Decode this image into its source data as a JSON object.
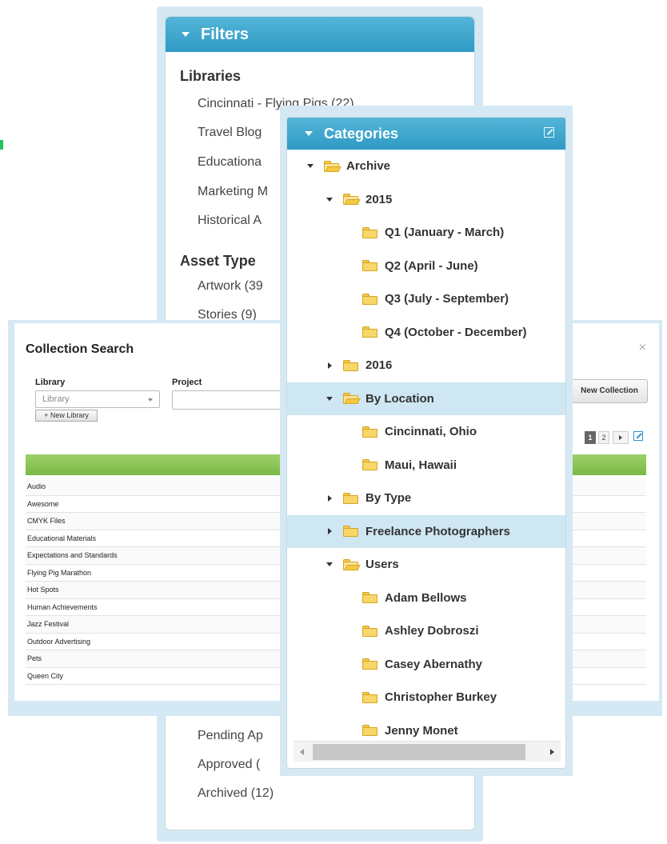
{
  "filters": {
    "title": "Filters",
    "libraries_heading": "Libraries",
    "libraries": [
      "Cincinnati - Flying Pigs (22)",
      "Travel Blog",
      "Educationa",
      "Marketing M",
      "Historical A"
    ],
    "asset_type_heading": "Asset Type",
    "asset_types": [
      "Artwork (39",
      "Stories (9)"
    ],
    "statuses": [
      "Pending Ap",
      "Approved (",
      "Archived (12)"
    ]
  },
  "collection_search": {
    "title": "Collection Search",
    "close": "×",
    "library_label": "Library",
    "library_placeholder": "Library",
    "project_label": "Project",
    "new_library": "+ New Library",
    "new_collection": "New Collection",
    "pages": [
      "1",
      "2"
    ],
    "rows": [
      "Audio",
      "Awesome",
      "CMYK Files",
      "Educational Materials",
      "Expectations and Standards",
      "Flying Pig Marathon",
      "Hot Spots",
      "Human Achievements",
      "Jazz Festival",
      "Outdoor Advertising",
      "Pets",
      "Queen City"
    ]
  },
  "categories": {
    "title": "Categories",
    "tree": [
      {
        "label": "Archive",
        "depth": 0,
        "toggle": "down",
        "open": true,
        "selected": false
      },
      {
        "label": "2015",
        "depth": 1,
        "toggle": "down",
        "open": true,
        "selected": false
      },
      {
        "label": "Q1 (January - March)",
        "depth": 2,
        "toggle": "none",
        "open": false,
        "selected": false
      },
      {
        "label": "Q2 (April - June)",
        "depth": 2,
        "toggle": "none",
        "open": false,
        "selected": false
      },
      {
        "label": "Q3 (July - September)",
        "depth": 2,
        "toggle": "none",
        "open": false,
        "selected": false
      },
      {
        "label": "Q4 (October - December)",
        "depth": 2,
        "toggle": "none",
        "open": false,
        "selected": false
      },
      {
        "label": "2016",
        "depth": 1,
        "toggle": "right",
        "open": false,
        "selected": false
      },
      {
        "label": "By Location",
        "depth": 1,
        "toggle": "down",
        "open": true,
        "selected": true
      },
      {
        "label": "Cincinnati, Ohio",
        "depth": 2,
        "toggle": "none",
        "open": false,
        "selected": false
      },
      {
        "label": "Maui, Hawaii",
        "depth": 2,
        "toggle": "none",
        "open": false,
        "selected": false
      },
      {
        "label": "By Type",
        "depth": 1,
        "toggle": "right",
        "open": false,
        "selected": false
      },
      {
        "label": "Freelance Photographers",
        "depth": 1,
        "toggle": "right",
        "open": false,
        "selected": true
      },
      {
        "label": "Users",
        "depth": 1,
        "toggle": "down",
        "open": true,
        "selected": false
      },
      {
        "label": "Adam Bellows",
        "depth": 2,
        "toggle": "none",
        "open": false,
        "selected": false
      },
      {
        "label": "Ashley Dobroszi",
        "depth": 2,
        "toggle": "none",
        "open": false,
        "selected": false
      },
      {
        "label": "Casey Abernathy",
        "depth": 2,
        "toggle": "none",
        "open": false,
        "selected": false
      },
      {
        "label": "Christopher Burkey",
        "depth": 2,
        "toggle": "none",
        "open": false,
        "selected": false
      },
      {
        "label": "Jenny Monet",
        "depth": 2,
        "toggle": "none",
        "open": false,
        "selected": false
      }
    ]
  },
  "colors": {
    "header_blue": "#3aa3cc",
    "panel_bg": "#d4e9f3",
    "green_bar": "#86c255",
    "selected_row": "#cfe7f2",
    "folder": "#f7d66a"
  }
}
